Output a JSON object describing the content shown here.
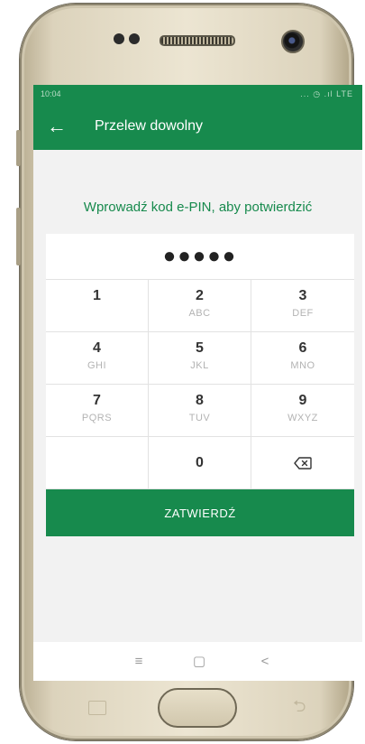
{
  "status_bar": {
    "time": "10:04",
    "icons": "... ◷ .ıl LTE"
  },
  "app_bar": {
    "back_icon": "←",
    "title": "Przelew dowolny"
  },
  "prompt": "Wprowadź kod e-PIN, aby potwierdzić",
  "pin": {
    "masked_value": "●●●●●",
    "digits_entered": 5
  },
  "keypad": {
    "keys": [
      {
        "digit": "1",
        "letters": ""
      },
      {
        "digit": "2",
        "letters": "ABC"
      },
      {
        "digit": "3",
        "letters": "DEF"
      },
      {
        "digit": "4",
        "letters": "GHI"
      },
      {
        "digit": "5",
        "letters": "JKL"
      },
      {
        "digit": "6",
        "letters": "MNO"
      },
      {
        "digit": "7",
        "letters": "PQRS"
      },
      {
        "digit": "8",
        "letters": "TUV"
      },
      {
        "digit": "9",
        "letters": "WXYZ"
      }
    ],
    "zero": "0",
    "backspace_icon": "backspace-icon"
  },
  "confirm_label": "ZATWIERDŹ",
  "nav": {
    "menu_glyph": "≡",
    "home_glyph": "▢",
    "back_glyph": "<"
  },
  "colors": {
    "brand_green": "#178a4d",
    "background": "#f2f2f2"
  }
}
